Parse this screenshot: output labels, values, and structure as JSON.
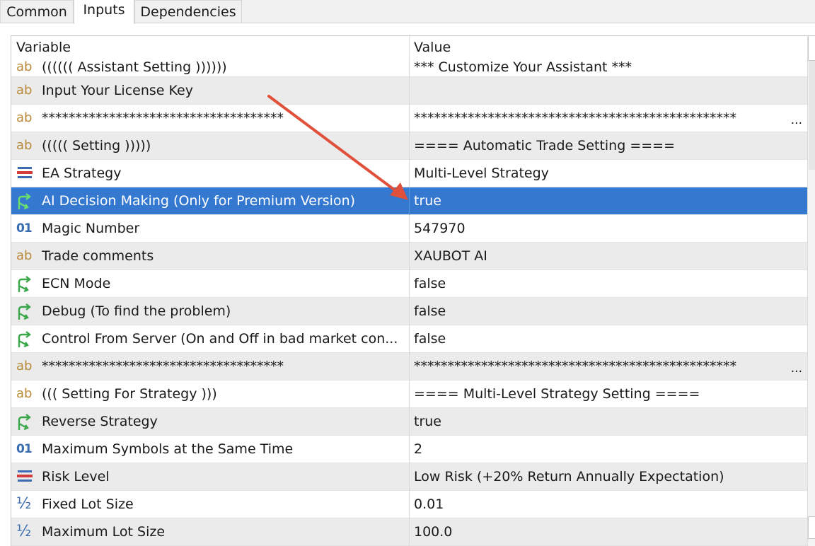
{
  "tabs": [
    {
      "label": "Common"
    },
    {
      "label": "Inputs"
    },
    {
      "label": "Dependencies"
    }
  ],
  "table": {
    "col_variable": "Variable",
    "col_value": "Value",
    "rows": [
      {
        "icon": "ab",
        "name": "(((((( Assistant Setting ))))))",
        "value": "*** Customize Your Assistant ***"
      },
      {
        "icon": "ab",
        "name": "Input Your License Key",
        "value": ""
      },
      {
        "icon": "ab",
        "name": "************************************",
        "value": "************************************************"
      },
      {
        "icon": "ab",
        "name": "((((( Setting )))))",
        "value": "==== Automatic Trade Setting ===="
      },
      {
        "icon": "list",
        "name": "EA Strategy",
        "value": "Multi-Level Strategy"
      },
      {
        "icon": "bool",
        "name": "AI Decision Making (Only for Premium Version)",
        "value": "true"
      },
      {
        "icon": "01",
        "name": "Magic Number",
        "value": "547970"
      },
      {
        "icon": "ab",
        "name": "Trade comments",
        "value": "XAUBOT AI"
      },
      {
        "icon": "bool",
        "name": "ECN Mode",
        "value": "false"
      },
      {
        "icon": "bool",
        "name": "Debug (To find the problem)",
        "value": "false"
      },
      {
        "icon": "bool",
        "name": "Control From Server (On and Off in bad market con...",
        "value": "false"
      },
      {
        "icon": "ab",
        "name": "************************************",
        "value": "************************************************"
      },
      {
        "icon": "ab",
        "name": "((( Setting For Strategy )))",
        "value": "==== Multi-Level Strategy Setting ===="
      },
      {
        "icon": "bool",
        "name": "Reverse Strategy",
        "value": "true"
      },
      {
        "icon": "01",
        "name": "Maximum Symbols at the Same Time",
        "value": "2"
      },
      {
        "icon": "list",
        "name": "Risk Level",
        "value": "Low Risk (+20% Return Annually Expectation)"
      },
      {
        "icon": "half",
        "name": "Fixed Lot Size",
        "value": "0.01"
      },
      {
        "icon": "half",
        "name": "Maximum Lot Size",
        "value": "100.0"
      }
    ],
    "selected_index": 5,
    "ellipsis": "..."
  },
  "colors": {
    "selected_bg": "#3578d0",
    "icon_text": "#b88a3a",
    "icon_number": "#3a6cb0",
    "icon_bool": "#3aa84a",
    "annotation_arrow": "#e0503a"
  }
}
